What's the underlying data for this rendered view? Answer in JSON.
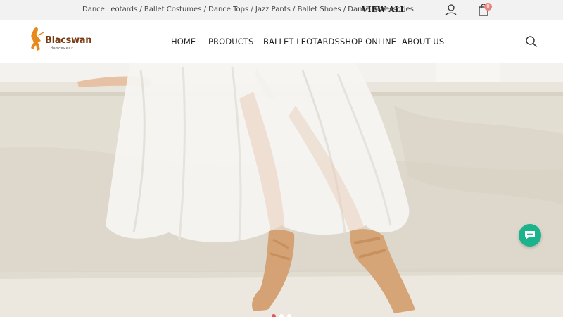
{
  "topbar": {
    "category_links": "Dance Leotards / Ballet Costumes / Dance Tops / Jazz Pants / Ballet Shoes / Dance Accessories",
    "view_all": "VIEW ALL",
    "cart_count": "0"
  },
  "logo": {
    "brand": "Blacswan",
    "tagline": "dancewear"
  },
  "nav": {
    "items": [
      {
        "label": "HOME"
      },
      {
        "label": "PRODUCTS"
      },
      {
        "label": "BALLET LEOTARDS"
      },
      {
        "label": "SHOP ONLINE"
      },
      {
        "label": "ABOUT US"
      }
    ]
  },
  "icons": {
    "user": "user-icon",
    "cart": "cart-icon",
    "search": "search-icon",
    "chat": "chat-icon"
  },
  "colors": {
    "accent": "#e8847f",
    "chat": "#1bb38c",
    "logo": "#e8891b"
  },
  "carousel": {
    "active_index": 0,
    "count": 3
  }
}
